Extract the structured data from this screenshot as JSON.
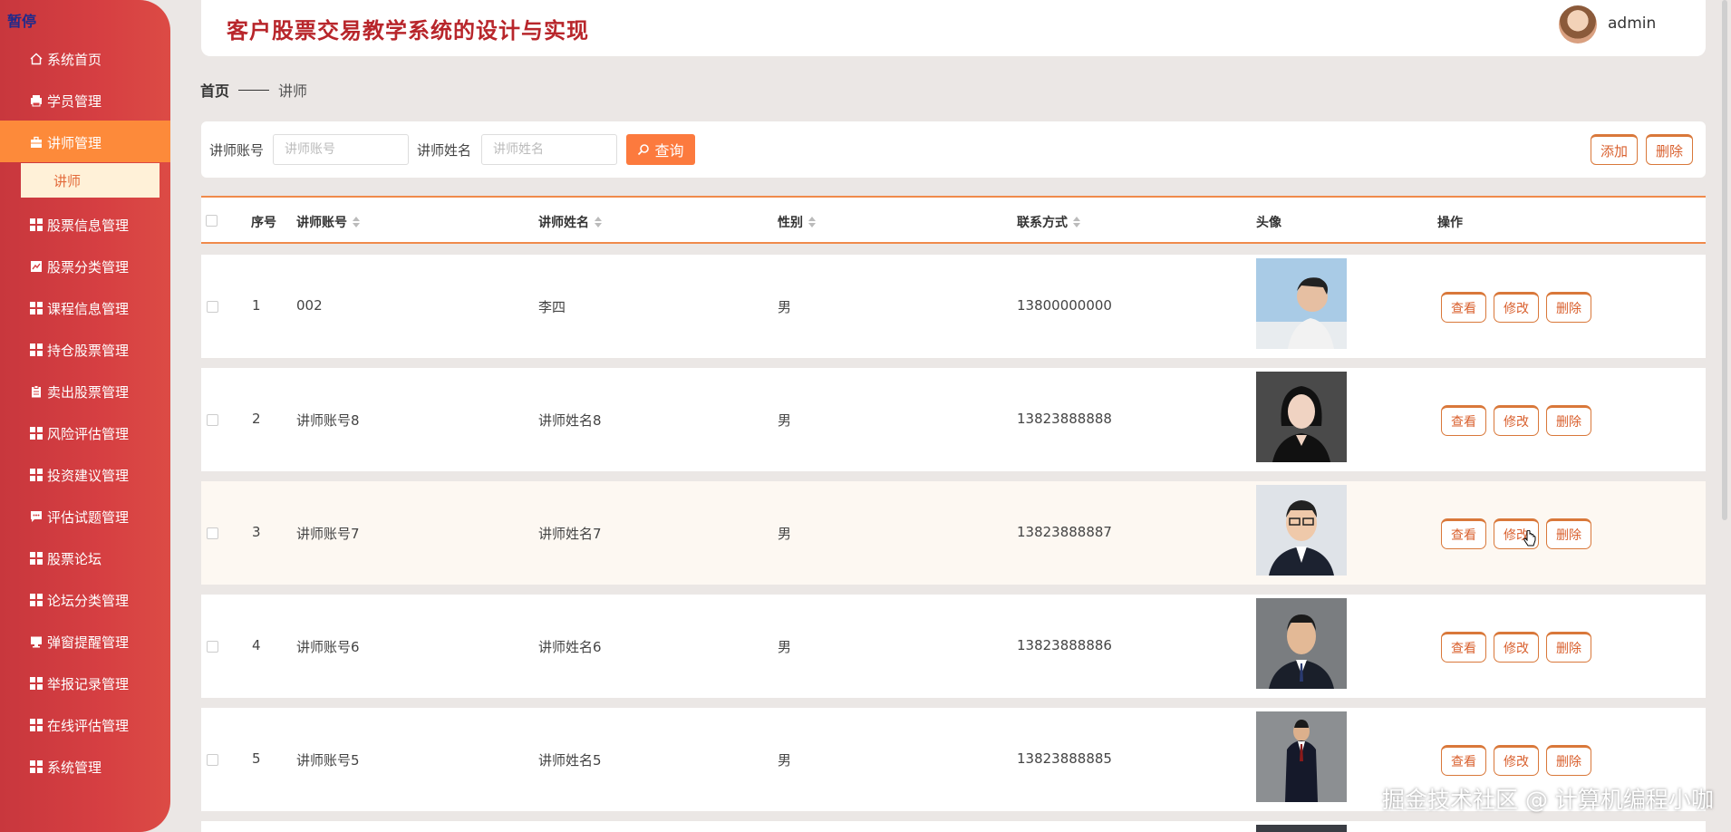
{
  "app": {
    "pause_label": "暂停",
    "title": "客户股票交易教学系统的设计与实现",
    "username": "admin"
  },
  "sidebar": {
    "items": [
      {
        "label": "系统首页",
        "icon": "home-icon"
      },
      {
        "label": "学员管理",
        "icon": "printer-icon"
      },
      {
        "label": "讲师管理",
        "icon": "briefcase-icon"
      },
      {
        "label": "股票信息管理",
        "icon": "grid-icon"
      },
      {
        "label": "股票分类管理",
        "icon": "chart-icon"
      },
      {
        "label": "课程信息管理",
        "icon": "grid-icon"
      },
      {
        "label": "持仓股票管理",
        "icon": "grid-icon"
      },
      {
        "label": "卖出股票管理",
        "icon": "clipboard-icon"
      },
      {
        "label": "风险评估管理",
        "icon": "grid-icon"
      },
      {
        "label": "投资建议管理",
        "icon": "grid-icon"
      },
      {
        "label": "评估试题管理",
        "icon": "comment-icon"
      },
      {
        "label": "股票论坛",
        "icon": "grid-icon"
      },
      {
        "label": "论坛分类管理",
        "icon": "grid-icon"
      },
      {
        "label": "弹窗提醒管理",
        "icon": "monitor-icon"
      },
      {
        "label": "举报记录管理",
        "icon": "grid-icon"
      },
      {
        "label": "在线评估管理",
        "icon": "grid-icon"
      },
      {
        "label": "系统管理",
        "icon": "grid-icon"
      }
    ],
    "submenu": "讲师"
  },
  "breadcrumb": {
    "home": "首页",
    "current": "讲师"
  },
  "search": {
    "account_label": "讲师账号",
    "account_placeholder": "讲师账号",
    "name_label": "讲师姓名",
    "name_placeholder": "讲师姓名",
    "query_label": "查询",
    "add_label": "添加",
    "delete_label": "删除"
  },
  "table": {
    "headers": {
      "index": "序号",
      "account": "讲师账号",
      "name": "讲师姓名",
      "gender": "性别",
      "contact": "联系方式",
      "avatar": "头像",
      "actions": "操作"
    },
    "action_labels": {
      "view": "查看",
      "edit": "修改",
      "delete": "删除"
    },
    "rows": [
      {
        "index": "1",
        "account": "002",
        "name": "李四",
        "gender": "男",
        "contact": "13800000000"
      },
      {
        "index": "2",
        "account": "讲师账号8",
        "name": "讲师姓名8",
        "gender": "男",
        "contact": "13823888888"
      },
      {
        "index": "3",
        "account": "讲师账号7",
        "name": "讲师姓名7",
        "gender": "男",
        "contact": "13823888887"
      },
      {
        "index": "4",
        "account": "讲师账号6",
        "name": "讲师姓名6",
        "gender": "男",
        "contact": "13823888886"
      },
      {
        "index": "5",
        "account": "讲师账号5",
        "name": "讲师姓名5",
        "gender": "男",
        "contact": "13823888885"
      }
    ]
  },
  "watermark": "掘金技术社区 @ 计算机编程小咖",
  "colors": {
    "sidebar": "#d63f42",
    "accent": "#fd8a3a",
    "title": "#b8262b"
  }
}
